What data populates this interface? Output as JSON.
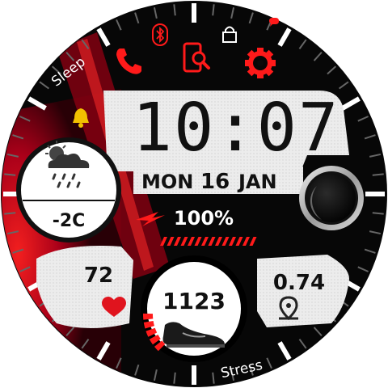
{
  "time": "10:07",
  "date": {
    "weekday": "MON",
    "day": "16",
    "month": "JAN"
  },
  "weather": {
    "temperature": "-2C",
    "icon": "cloud-sun-rain-icon"
  },
  "battery": {
    "percent": "100%",
    "level": 1.0
  },
  "heart_rate": {
    "value": "72",
    "icon": "heart-icon"
  },
  "steps": {
    "value": "1123",
    "icon": "sneaker-icon"
  },
  "distance": {
    "value": "0.74",
    "icon": "location-pin-icon"
  },
  "ring_labels": {
    "top_left": "Sleep",
    "bottom": "Stress"
  },
  "shortcuts": [
    "phone-icon",
    "phone-search-icon",
    "settings-icon"
  ],
  "status_icons": [
    "bluetooth-icon",
    "lock-icon",
    "notification-dot-icon",
    "alarm-bell-icon"
  ],
  "colors": {
    "accent": "#ff1a1a",
    "bezel": "#0a0a0a",
    "panel": "#e9e9e9",
    "text": "#111111"
  }
}
